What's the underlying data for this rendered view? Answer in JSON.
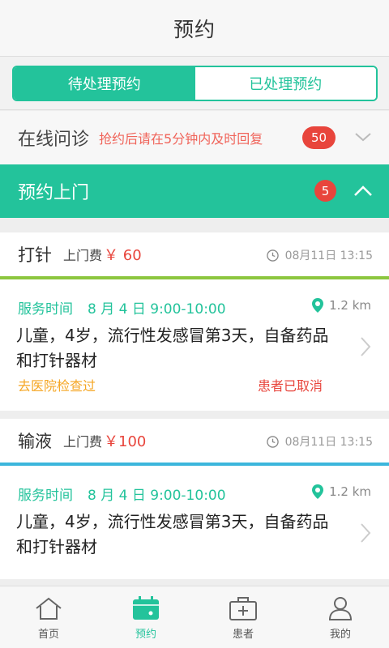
{
  "header": {
    "title": "预约"
  },
  "tabs": [
    {
      "label": "待处理预约",
      "active": true
    },
    {
      "label": "已处理预约",
      "active": false
    }
  ],
  "online_consult": {
    "label": "在线问诊",
    "hint": "抢约后请在5分钟内及时回复",
    "count": "50",
    "icon": "chevron-down-icon"
  },
  "home_visit": {
    "label": "预约上门",
    "count": "5",
    "icon": "chevron-up-icon"
  },
  "appointments": [
    {
      "service": "打针",
      "fee_label": "上门费",
      "fee": "￥ 60",
      "timestamp": "08月11日 13:15",
      "service_time_label": "服务时间",
      "service_time": "8 月 4 日 9:00-10:00",
      "distance": "1.2 km",
      "description": "儿童，4岁，流行性发感冒第3天，自备药品和打针器材",
      "note": "去医院检查过",
      "status": "患者已取消",
      "strip_color": "#8cc63f"
    },
    {
      "service": "输液",
      "fee_label": "上门费",
      "fee": "￥100",
      "timestamp": "08月11日 13:15",
      "service_time_label": "服务时间",
      "service_time": "8 月 4 日 9:00-10:00",
      "distance": "1.2 km",
      "description": "儿童，4岁，流行性发感冒第3天，自备药品和打针器材",
      "note": "",
      "status": "",
      "strip_color": "#3bb6dc"
    }
  ],
  "bottom_nav": [
    {
      "label": "首页",
      "icon": "home-icon",
      "active": false
    },
    {
      "label": "预约",
      "icon": "calendar-icon",
      "active": true
    },
    {
      "label": "患者",
      "icon": "medical-kit-icon",
      "active": false
    },
    {
      "label": "我的",
      "icon": "user-icon",
      "active": false
    }
  ],
  "colors": {
    "accent": "#23c39b",
    "badge": "#e8453c",
    "warning": "#f5a623"
  }
}
